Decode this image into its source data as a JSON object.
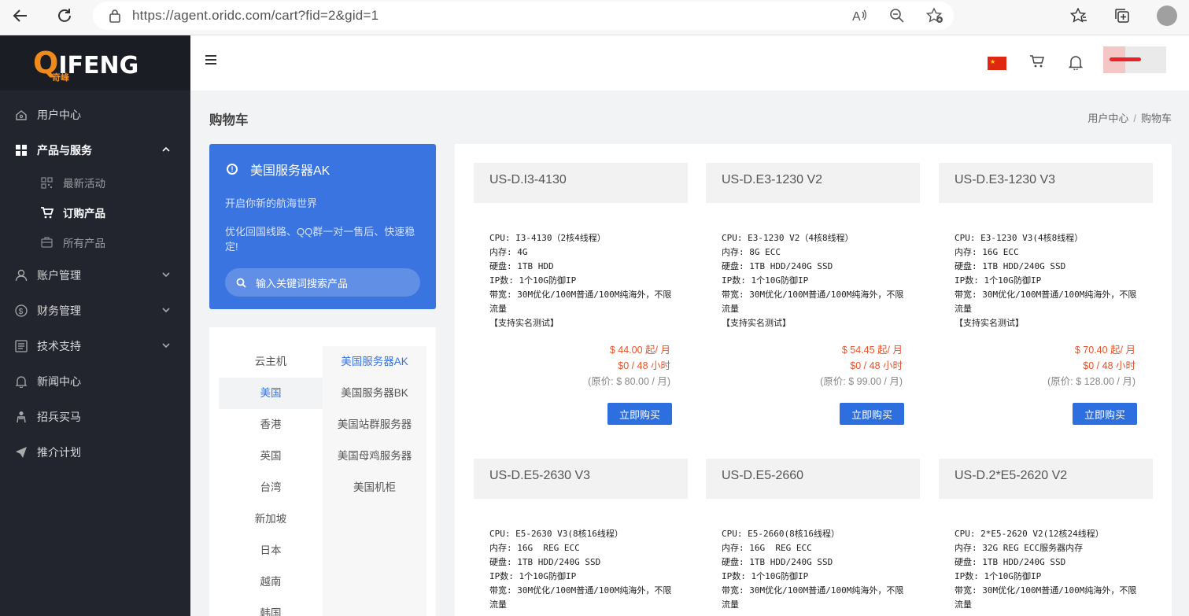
{
  "browser": {
    "url": "https://agent.oridc.com/cart?fid=2&gid=1"
  },
  "logo": {
    "q": "Q",
    "rest": "IFENG",
    "sub": "奇峰"
  },
  "sidebar": {
    "items": [
      {
        "label": "用户中心",
        "icon": "home-icon"
      },
      {
        "label": "产品与服务",
        "icon": "grid-icon",
        "active": true
      },
      {
        "label": "账户管理",
        "icon": "user-icon"
      },
      {
        "label": "财务管理",
        "icon": "dollar-icon"
      },
      {
        "label": "技术支持",
        "icon": "list-icon"
      },
      {
        "label": "新闻中心",
        "icon": "bell-icon"
      },
      {
        "label": "招兵买马",
        "icon": "recruit-icon"
      },
      {
        "label": "推介计划",
        "icon": "send-icon"
      }
    ],
    "sub_items": [
      {
        "label": "最新活动",
        "icon": "qrcode-icon"
      },
      {
        "label": "订购产品",
        "icon": "cart-icon",
        "active": true
      },
      {
        "label": "所有产品",
        "icon": "box-icon"
      }
    ]
  },
  "page": {
    "title": "购物车",
    "breadcrumb": [
      "用户中心",
      "购物车"
    ]
  },
  "promo": {
    "title": "美国服务器AK",
    "line1": "开启你新的航海世界",
    "line2": "优化回国线路、QQ群一对一售后、快速稳定!",
    "search_placeholder": "输入关键词搜索产品"
  },
  "categories": {
    "left": [
      "云主机",
      "美国",
      "香港",
      "英国",
      "台湾",
      "新加坡",
      "日本",
      "越南",
      "韩国"
    ],
    "right": [
      "美国服务器AK",
      "美国服务器BK",
      "美国站群服务器",
      "美国母鸡服务器",
      "美国机柜"
    ]
  },
  "products": [
    {
      "name": "US-D.I3-4130",
      "spec": "CPU: I3-4130（2核4线程）\n内存: 4G\n硬盘: 1TB HDD\nIP数: 1个10G防御IP\n带宽: 30M优化/100M普通/100M纯海外，不限流量\n【支持实名测试】",
      "price": "$ 44.00 起/ 月",
      "trial": "$0 / 48 小时",
      "original": "(原价: $ 80.00 / 月)",
      "button": "立即购买"
    },
    {
      "name": "US-D.E3-1230 V2",
      "spec": "CPU: E3-1230 V2（4核8线程）\n内存: 8G ECC\n硬盘: 1TB HDD/240G SSD\nIP数: 1个10G防御IP\n带宽: 30M优化/100M普通/100M纯海外，不限流量\n【支持实名测试】",
      "price": "$ 54.45 起/ 月",
      "trial": "$0 / 48 小时",
      "original": "(原价: $ 99.00 / 月)",
      "button": "立即购买"
    },
    {
      "name": "US-D.E3-1230 V3",
      "spec": "CPU: E3-1230 V3(4核8线程）\n内存: 16G ECC\n硬盘: 1TB HDD/240G SSD\nIP数: 1个10G防御IP\n带宽: 30M优化/100M普通/100M纯海外，不限流量\n【支持实名测试】",
      "price": "$ 70.40 起/ 月",
      "trial": "$0 / 48 小时",
      "original": "(原价: $ 128.00 / 月)",
      "button": "立即购买"
    },
    {
      "name": "US-D.E5-2630 V3",
      "spec": "CPU: E5-2630 V3(8核16线程）\n内存: 16G  REG ECC\n硬盘: 1TB HDD/240G SSD\nIP数: 1个10G防御IP\n带宽: 30M优化/100M普通/100M纯海外，不限流量",
      "price": "",
      "trial": "",
      "original": "",
      "button": ""
    },
    {
      "name": "US-D.E5-2660",
      "spec": "CPU: E5-2660(8核16线程）\n内存: 16G  REG ECC\n硬盘: 1TB HDD/240G SSD\nIP数: 1个10G防御IP\n带宽: 30M优化/100M普通/100M纯海外，不限流量",
      "price": "",
      "trial": "",
      "original": "",
      "button": ""
    },
    {
      "name": "US-D.2*E5-2620 V2",
      "spec": "CPU: 2*E5-2620 V2(12核24线程）\n内存: 32G REG ECC服务器内存\n硬盘: 1TB HDD/240G SSD\nIP数: 1个10G防御IP\n带宽: 30M优化/100M普通/100M纯海外，不限流量",
      "price": "",
      "trial": "",
      "original": "",
      "button": ""
    }
  ],
  "colors": {
    "accent": "#3a74e0",
    "price": "#e8532a",
    "sidebar": "#22252e"
  }
}
